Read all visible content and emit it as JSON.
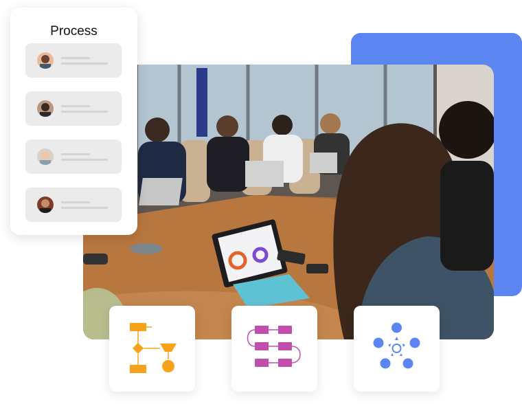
{
  "process": {
    "title": "Process",
    "rows": [
      {
        "avatar": "avatar-1"
      },
      {
        "avatar": "avatar-2"
      },
      {
        "avatar": "avatar-3"
      },
      {
        "avatar": "avatar-4"
      }
    ]
  },
  "tiles": [
    {
      "icon": "flowchart-icon",
      "color": "#f7a21b"
    },
    {
      "icon": "process-flow-icon",
      "color": "#c14fae"
    },
    {
      "icon": "network-icon",
      "color": "#5b86f2"
    }
  ],
  "colors": {
    "accent_panel": "#5b86f2",
    "card_row": "#ebebeb"
  }
}
